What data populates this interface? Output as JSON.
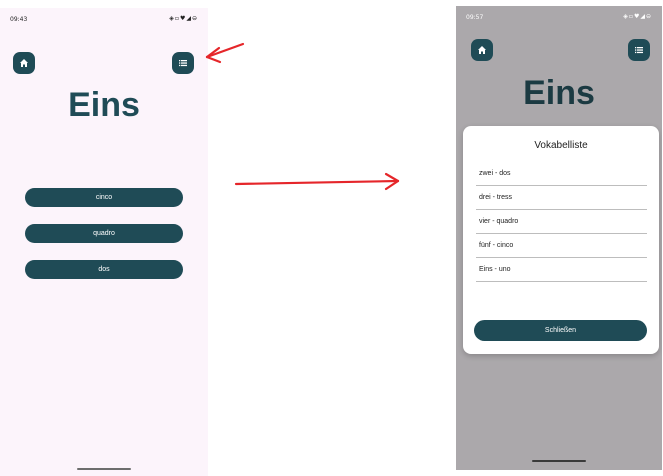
{
  "left_screen": {
    "status_time": "09:43",
    "status_icons": "◈▫♥◢⊖",
    "home_icon": "home-icon",
    "list_icon": "list-icon",
    "title": "Eins",
    "answers": [
      "cinco",
      "quadro",
      "dos"
    ]
  },
  "right_screen": {
    "status_time": "09:57",
    "status_icons": "◈▫♥◢⊖",
    "home_icon": "home-icon",
    "list_icon": "list-icon",
    "title": "Eins",
    "dialog": {
      "title": "Vokabelliste",
      "items": [
        "zwei - dos",
        "drei - tress",
        "vier - quadro",
        "fünf - cinco",
        "Eins - uno"
      ],
      "close_label": "Schließen"
    }
  },
  "annotation_color": "#e5262a",
  "theme_color": "#1f4b56"
}
